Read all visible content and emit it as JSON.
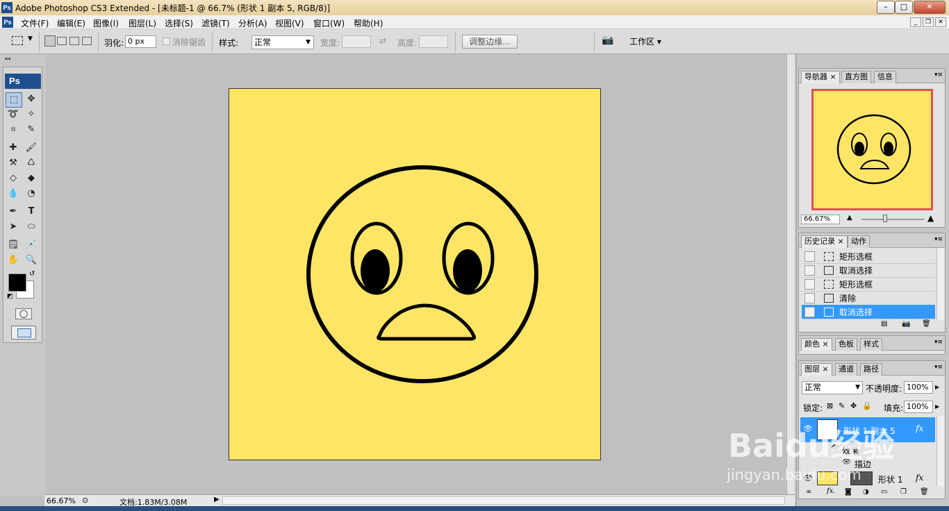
{
  "window": {
    "title": "Adobe Photoshop CS3 Extended - [未标题-1 @ 66.7% (形状 1 副本 5, RGB/8)]",
    "app_icon": "Ps"
  },
  "menu": [
    "文件(F)",
    "编辑(E)",
    "图像(I)",
    "图层(L)",
    "选择(S)",
    "滤镜(T)",
    "分析(A)",
    "视图(V)",
    "窗口(W)",
    "帮助(H)"
  ],
  "options": {
    "feather_label": "羽化:",
    "feather_value": "0 px",
    "antialias_label": "消除锯齿",
    "style_label": "样式:",
    "style_value": "正常",
    "width_label": "宽度:",
    "height_label": "高度:",
    "refine_edge": "调整边缘...",
    "workspace": "工作区 ▾"
  },
  "toolbox": {
    "logo": "Ps"
  },
  "statusbar": {
    "zoom": "66.67%",
    "doc": "文档:1.83M/3.08M"
  },
  "navigator": {
    "tabs": [
      "导航器",
      "直方图",
      "信息"
    ],
    "zoom": "66.67%"
  },
  "history": {
    "tabs": [
      "历史记录",
      "动作"
    ],
    "items": [
      "矩形选框",
      "取消选择",
      "矩形选框",
      "清除",
      "取消选择"
    ],
    "selected_index": 4
  },
  "color_panel": {
    "tabs": [
      "颜色",
      "色板",
      "样式"
    ]
  },
  "layers": {
    "tabs": [
      "图层",
      "通道",
      "路径"
    ],
    "blend_mode": "正常",
    "opacity_label": "不透明度:",
    "opacity": "100%",
    "lock_label": "锁定:",
    "fill_label": "填充:",
    "fill": "100%",
    "layer_name": "形状 1 副本 5",
    "effects_label": "效果",
    "stroke_label": "描边",
    "layer2_name": "形状 1"
  },
  "colors": {
    "canvas_yellow": "#ffe566",
    "selection_blue": "#3399ff",
    "nav_frame": "#e05050"
  },
  "watermark": {
    "logo": "Baidu经验",
    "url": "jingyan.baidu.com"
  }
}
